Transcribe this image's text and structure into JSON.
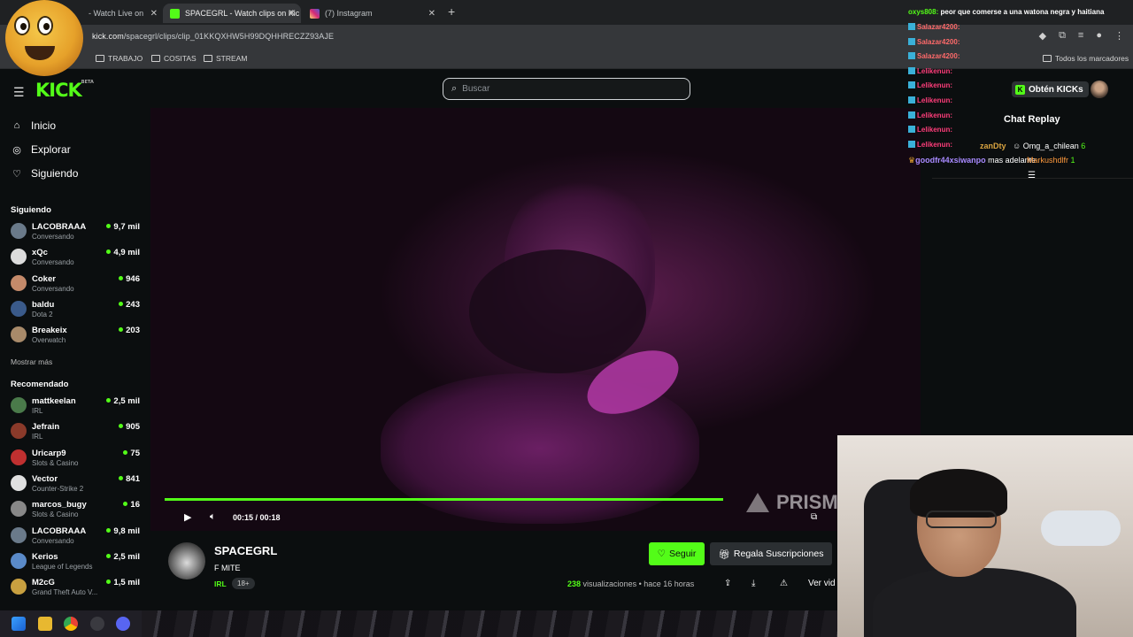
{
  "browser": {
    "tabs": [
      {
        "title": "- Watch Live on",
        "color": "#2a2a2a"
      },
      {
        "title": "SPACEGRL - Watch clips on Kic",
        "color": "#53fc18"
      },
      {
        "title": "(7) Instagram",
        "color": "#d6249f"
      }
    ],
    "url_host": "kick.com",
    "url_path": "/spacegrl/clips/clip_01KKQXHW5H99DQHHRECZZ93AJE",
    "bookmarks": [
      "TRABAJO",
      "COSITAS",
      "STREAM"
    ],
    "all_bookmarks": "Todos los marcadores"
  },
  "header": {
    "logo": "KICK",
    "logo_badge": "BETA",
    "search_placeholder": "Buscar",
    "get_kicks": "Obtén KICKs"
  },
  "nav": [
    {
      "label": "Inicio",
      "icon": "⌂"
    },
    {
      "label": "Explorar",
      "icon": "◎"
    },
    {
      "label": "Siguiendo",
      "icon": "♡"
    }
  ],
  "following": {
    "title": "Siguiendo",
    "channels": [
      {
        "name": "LACOBRAAA",
        "category": "Conversando",
        "viewers": "9,7 mil",
        "color": "#6a7a8a"
      },
      {
        "name": "xQc",
        "category": "Conversando",
        "viewers": "4,9 mil",
        "color": "#dcdcdc"
      },
      {
        "name": "Coker",
        "category": "Conversando",
        "viewers": "946",
        "color": "#c48a6a"
      },
      {
        "name": "baldu",
        "category": "Dota 2",
        "viewers": "243",
        "color": "#3a5a8a"
      },
      {
        "name": "Breakeix",
        "category": "Overwatch",
        "viewers": "203",
        "color": "#a88a6a"
      }
    ],
    "show_more": "Mostrar más"
  },
  "recommended": {
    "title": "Recomendado",
    "channels": [
      {
        "name": "mattkeelan",
        "category": "IRL",
        "viewers": "2,5 mil",
        "color": "#4a7a4a"
      },
      {
        "name": "Jefrain",
        "category": "IRL",
        "viewers": "905",
        "color": "#8a3a2a"
      },
      {
        "name": "Uricarp9",
        "category": "Slots & Casino",
        "viewers": "75",
        "color": "#c03030"
      },
      {
        "name": "Vector",
        "category": "Counter-Strike 2",
        "viewers": "841",
        "color": "#e0e0e0"
      },
      {
        "name": "marcos_bugy",
        "category": "Slots & Casino",
        "viewers": "16",
        "color": "#888"
      },
      {
        "name": "LACOBRAAA",
        "category": "Conversando",
        "viewers": "9,8 mil",
        "color": "#6a7a8a"
      },
      {
        "name": "Kerios",
        "category": "League of Legends",
        "viewers": "2,5 mil",
        "color": "#5a8ac8"
      },
      {
        "name": "M2cG",
        "category": "Grand Theft Auto V...",
        "viewers": "1,5 mil",
        "color": "#c8a040"
      }
    ]
  },
  "player": {
    "time": "00:15 / 00:18",
    "progress": 0.83,
    "watermark": "PRISM"
  },
  "clip": {
    "channel": "SPACEGRL",
    "title": "F MITE",
    "category": "IRL",
    "age": "18+",
    "follow": "Seguir",
    "gift": "Regala Suscripciones",
    "views_count": "238",
    "views_label": "visualizaciones",
    "ago": "• hace 16 horas",
    "view_more": "Ver vid"
  },
  "chat": {
    "title": "Chat Replay",
    "messages": [
      {
        "user": "zanDty",
        "text": "",
        "color": "#d9a441"
      },
      {
        "user": "Omg_a_chilean",
        "text": "6",
        "color": "#ffffff"
      },
      {
        "user": "goodfr44xsiwanpo",
        "text": "mas adelante",
        "color": "#a88aff"
      },
      {
        "user": "Markushdlfr",
        "text": "1",
        "color": "#ff9a3d"
      }
    ]
  },
  "overlay_chat": [
    {
      "user": "oxys808:",
      "text": "peor que comerse a una watona negra y haitiana",
      "color": "#53fc18"
    },
    {
      "user": "Salazar4200:",
      "text": "",
      "color": "#ff6a6a"
    },
    {
      "user": "Salazar4200:",
      "text": "",
      "color": "#ff6a6a"
    },
    {
      "user": "Salazar4200:",
      "text": "",
      "color": "#ff6a6a"
    },
    {
      "user": "Lelikenun:",
      "text": "",
      "color": "#ff3d7a"
    },
    {
      "user": "Lelikenun:",
      "text": "",
      "color": "#ff3d7a"
    },
    {
      "user": "Lelikenun:",
      "text": "",
      "color": "#ff3d7a"
    },
    {
      "user": "Lelikenun:",
      "text": "",
      "color": "#ff3d7a"
    },
    {
      "user": "Lelikenun:",
      "text": "",
      "color": "#ff3d7a"
    },
    {
      "user": "Lelikenun:",
      "text": "",
      "color": "#ff3d7a"
    }
  ],
  "colors": {
    "accent": "#53fc18",
    "bg": "#0b0e0f"
  }
}
